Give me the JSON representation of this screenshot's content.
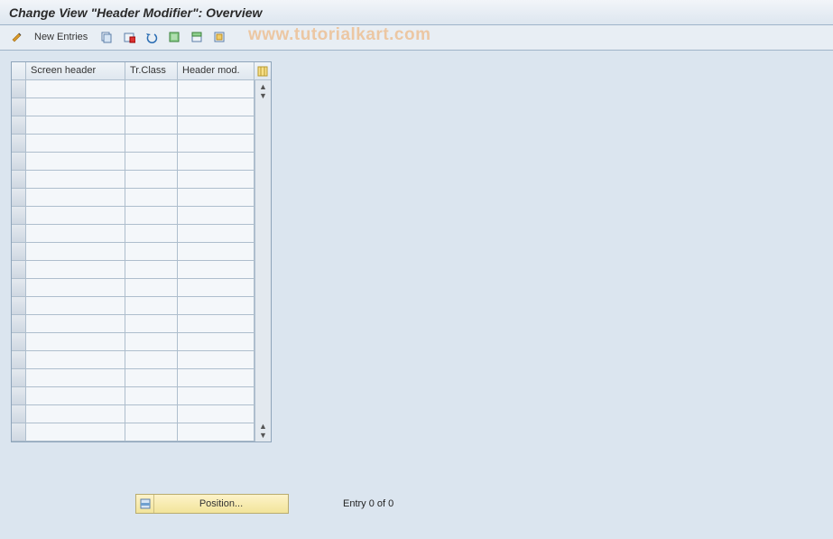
{
  "title": "Change View \"Header Modifier\": Overview",
  "watermark": "www.tutorialkart.com",
  "toolbar": {
    "new_entries_label": "New Entries"
  },
  "grid": {
    "columns": {
      "screen_header": "Screen header",
      "tr_class": "Tr.Class",
      "header_mod": "Header mod."
    },
    "row_count": 20
  },
  "footer": {
    "position_label": "Position...",
    "entry_status": "Entry 0 of 0"
  }
}
